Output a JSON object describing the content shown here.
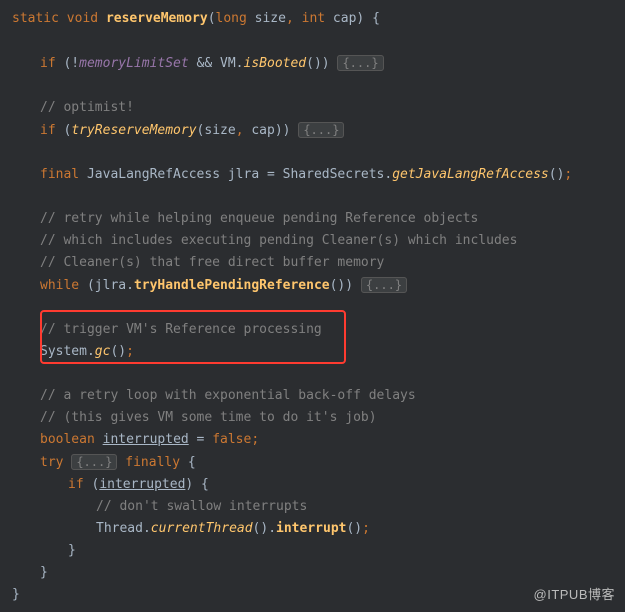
{
  "code": {
    "l1_static": "static",
    "l1_void": "void",
    "l1_method": "reserveMemory",
    "l1_lp": "(",
    "l1_long": "long",
    "l1_size": " size",
    "l1_comma": ",",
    "l1_int": " int",
    "l1_cap": " cap",
    "l1_rp": ")",
    "l1_ob": " {",
    "l3_if": "if",
    "l3_lp": " (!",
    "l3_mem": "memoryLimitSet",
    "l3_and": " && VM.",
    "l3_boot": "isBooted",
    "l3_rp": "()) ",
    "fold": "{...}",
    "l5_c": "// optimist!",
    "l6_if": "if",
    "l6_lp": " (",
    "l6_try": "tryReserveMemory",
    "l6_args": "(size",
    "l6_comma": ",",
    "l6_cap": " cap)) ",
    "l8_final": "final",
    "l8_type": " JavaLangRefAccess jlra = SharedSecrets.",
    "l8_get": "getJavaLangRefAccess",
    "l8_end": "()",
    "l8_semi": ";",
    "l10_c": "// retry while helping enqueue pending Reference objects",
    "l11_c": "// which includes executing pending Cleaner(s) which includes",
    "l12_c": "// Cleaner(s) that free direct buffer memory",
    "l13_while": "while",
    "l13_lp": " (jlra.",
    "l13_m": "tryHandlePendingReference",
    "l13_rp": "()) ",
    "l15_c": "// trigger VM's Reference processing",
    "l16_sys": "System.",
    "l16_gc": "gc",
    "l16_p": "()",
    "l16_semi": ";",
    "l18_c": "// a retry loop with exponential back-off delays",
    "l19_c": "// (this gives VM some time to do it's job)",
    "l20_bool": "boolean",
    "l20_sp": " ",
    "l20_int": "interrupted",
    "l20_eq": " = ",
    "l20_false": "false",
    "l20_semi": ";",
    "l21_try": "try",
    "l21_sp": " ",
    "l21_fin": " finally",
    "l21_ob": " {",
    "l22_if": "if",
    "l22_lp": " (",
    "l22_int": "interrupted",
    "l22_rp": ") {",
    "l23_c": "// don't swallow interrupts",
    "l24_th": "Thread.",
    "l24_cur": "currentThread",
    "l24_p1": "().",
    "l24_int": "interrupt",
    "l24_p2": "()",
    "l24_semi": ";",
    "l25_cb": "}",
    "l26_cb": "}",
    "l27_cb": "}"
  },
  "watermark": "@ITPUB博客"
}
